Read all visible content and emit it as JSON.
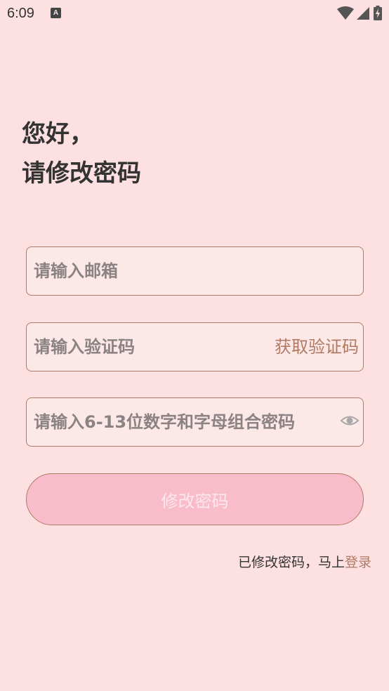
{
  "status_bar": {
    "time": "6:09",
    "app_icon_letter": "A",
    "wifi_icon": "wifi-icon",
    "signal_icon": "cell-signal-icon",
    "battery_icon": "battery-charging-icon"
  },
  "heading": {
    "line1": "您好，",
    "line2": "请修改密码"
  },
  "form": {
    "email_placeholder": "请输入邮箱",
    "email_value": "",
    "code_placeholder": "请输入验证码",
    "code_value": "",
    "get_code_label": "获取验证码",
    "password_placeholder": "请输入6-13位数字和字母组合密码",
    "password_value": "",
    "password_toggle_icon": "eye-icon",
    "submit_label": "修改密码"
  },
  "footer": {
    "prompt_text": "已修改密码，马上",
    "login_link": "登录"
  },
  "colors": {
    "background": "#fde0e1",
    "accent": "#b07a62",
    "button_fill": "#f8bccb",
    "text_dark": "#333333",
    "placeholder": "#8a8283"
  }
}
